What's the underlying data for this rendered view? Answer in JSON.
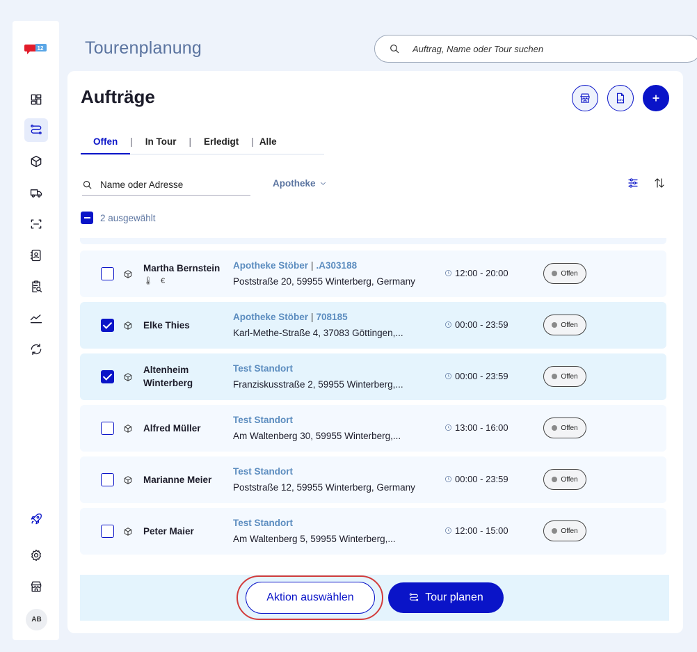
{
  "header": {
    "title": "Tourenplanung",
    "search_placeholder": "Auftrag, Name oder Tour suchen"
  },
  "sidebar": {
    "avatar_initials": "AB",
    "items": [
      {
        "icon": "dashboard-icon"
      },
      {
        "icon": "route-icon",
        "active": true
      },
      {
        "icon": "package-icon"
      },
      {
        "icon": "truck-icon"
      },
      {
        "icon": "scan-icon"
      },
      {
        "icon": "contacts-icon"
      },
      {
        "icon": "clipboard-search-icon"
      },
      {
        "icon": "analytics-icon"
      },
      {
        "icon": "sync-icon"
      }
    ],
    "bottom_items": [
      {
        "icon": "rocket-icon"
      },
      {
        "icon": "gear-icon"
      },
      {
        "icon": "store-icon"
      }
    ]
  },
  "main": {
    "title": "Aufträge",
    "tabs": [
      {
        "label": "Offen",
        "active": true
      },
      {
        "label": "In Tour"
      },
      {
        "label": "Erledigt"
      },
      {
        "label": "Alle"
      }
    ],
    "filter_placeholder": "Name oder Adresse",
    "location_filter": "Apotheke",
    "selected_count_label": "2 ausgewählt",
    "orders": [
      {
        "name": "Martha Bernstein",
        "tags": "🌡 €",
        "location": "Apotheke Stöber",
        "order_id": ".A303188",
        "address": "Poststraße 20, 59955 Winterberg, Germany",
        "time": "12:00 - 20:00",
        "status": "Offen",
        "checked": false
      },
      {
        "name": "Elke Thies",
        "location": "Apotheke Stöber",
        "order_id": "708185",
        "address": "Karl-Methe-Straße 4, 37083 Göttingen,...",
        "time": "00:00 - 23:59",
        "status": "Offen",
        "checked": true
      },
      {
        "name": "Altenheim Winterberg",
        "location": "Test Standort",
        "address": "Franziskusstraße 2, 59955 Winterberg,...",
        "time": "00:00 - 23:59",
        "status": "Offen",
        "checked": true
      },
      {
        "name": "Alfred Müller",
        "location": "Test Standort",
        "address": "Am Waltenberg 30, 59955 Winterberg,...",
        "time": "13:00 - 16:00",
        "status": "Offen",
        "checked": false
      },
      {
        "name": "Marianne Meier",
        "location": "Test Standort",
        "address": "Poststraße 12, 59955 Winterberg, Germany",
        "time": "00:00 - 23:59",
        "status": "Offen",
        "checked": false
      },
      {
        "name": "Peter Maier",
        "location": "Test Standort",
        "address": "Am Waltenberg 5, 59955 Winterberg,...",
        "time": "12:00 - 15:00",
        "status": "Offen",
        "checked": false
      }
    ]
  },
  "actions": {
    "select_action": "Aktion auswählen",
    "plan_tour": "Tour planen"
  },
  "colors": {
    "primary": "#0a14c8",
    "title_muted": "#5b74a0",
    "location_link": "#5b8cbf",
    "highlight": "#d23c3c"
  }
}
